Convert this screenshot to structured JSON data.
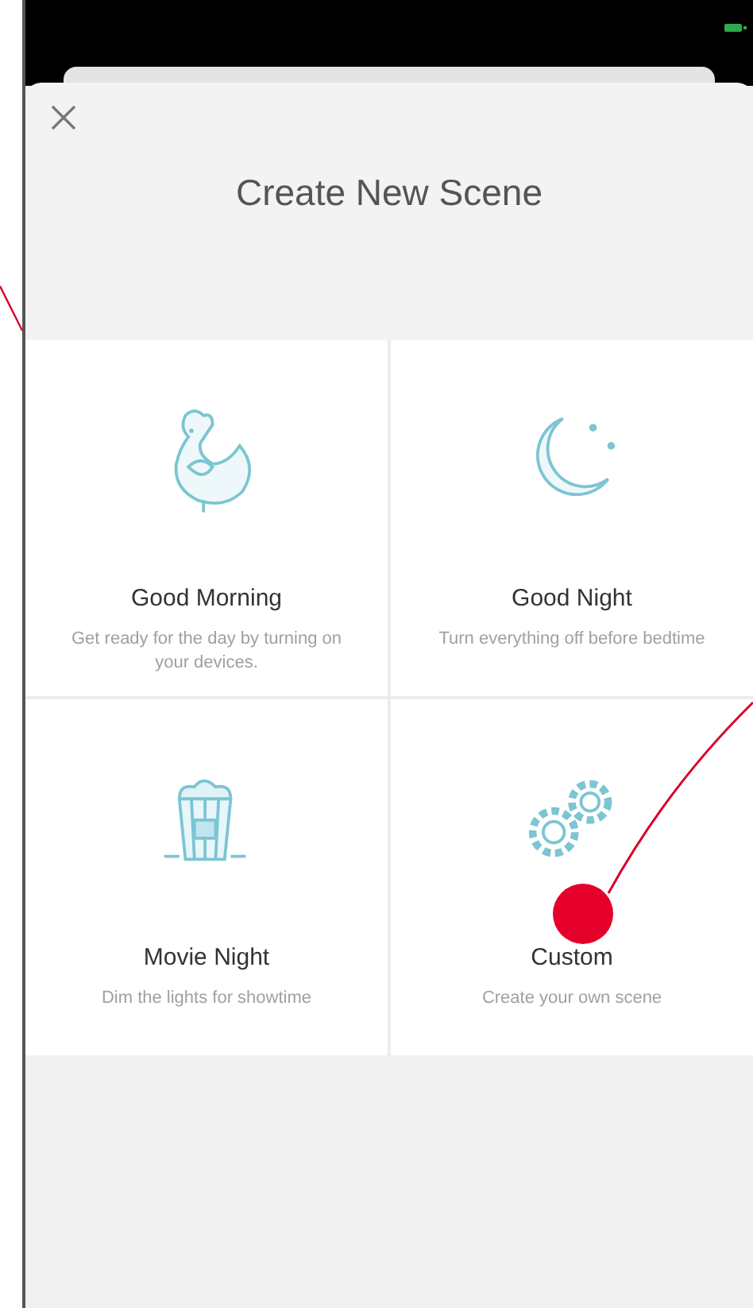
{
  "title": "Create New Scene",
  "scenes": [
    {
      "title": "Good Morning",
      "description": "Get ready for the day by turning on your devices."
    },
    {
      "title": "Good Night",
      "description": "Turn everything off before bedtime"
    },
    {
      "title": "Movie Night",
      "description": "Dim the lights for showtime"
    },
    {
      "title": "Custom",
      "description": "Create your own scene"
    }
  ]
}
